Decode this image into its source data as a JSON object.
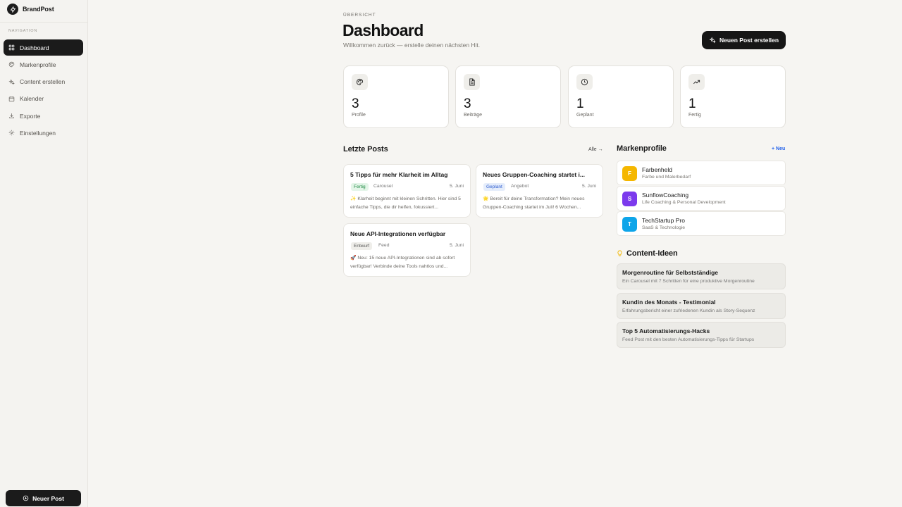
{
  "sidebar": {
    "brand": "BrandPost",
    "nav_header": "NAVIGATION",
    "items": [
      {
        "label": "Dashboard",
        "icon": "grid-icon",
        "active": true
      },
      {
        "label": "Markenprofile",
        "icon": "palette-icon",
        "active": false
      },
      {
        "label": "Content erstellen",
        "icon": "sparkles-icon",
        "active": false
      },
      {
        "label": "Kalender",
        "icon": "calendar-icon",
        "active": false
      },
      {
        "label": "Exporte",
        "icon": "download-icon",
        "active": false
      },
      {
        "label": "Einstellungen",
        "icon": "gear-icon",
        "active": false
      }
    ],
    "new_post_label": "Neuer Post"
  },
  "header": {
    "eyebrow": "ÜBERSICHT",
    "title": "Dashboard",
    "subtitle": "Willkommen zurück — erstelle deinen nächsten Hit.",
    "cta_label": "Neuen Post erstellen"
  },
  "stats": [
    {
      "value": "3",
      "label": "Profile",
      "icon": "palette-icon"
    },
    {
      "value": "3",
      "label": "Beiträge",
      "icon": "document-icon"
    },
    {
      "value": "1",
      "label": "Geplant",
      "icon": "clock-icon"
    },
    {
      "value": "1",
      "label": "Fertig",
      "icon": "trending-up-icon"
    }
  ],
  "recent_posts": {
    "title": "Letzte Posts",
    "all_label": "Alle →",
    "items": [
      {
        "title": "5 Tipps für mehr Klarheit im Alltag",
        "status": "Fertig",
        "type": "Carousel",
        "date": "5. Juni",
        "text": "✨ Klarheit beginnt mit kleinen Schritten. Hier sind 5 einfache Tipps, die dir helfen, fokussiert..."
      },
      {
        "title": "Neues Gruppen-Coaching startet i...",
        "status": "Geplant",
        "type": "Angebot",
        "date": "5. Juni",
        "text": "🌟 Bereit für deine Transformation? Mein neues Gruppen-Coaching startet im Juli! 6 Wochen..."
      },
      {
        "title": "Neue API-Integrationen verfügbar",
        "status": "Entwurf",
        "type": "Feed",
        "date": "5. Juni",
        "text": "🚀 Neu: 15 neue API-Integrationen sind ab sofort verfügbar! Verbinde deine Tools nahtlos und..."
      }
    ]
  },
  "profiles": {
    "title": "Markenprofile",
    "new_label": "+ Neu",
    "items": [
      {
        "initial": "F",
        "name": "Farbenheld",
        "sub": "Farbe und Malerbedarf",
        "color": "#f5b700"
      },
      {
        "initial": "S",
        "name": "SunflowCoaching",
        "sub": "Life Coaching & Personal Development",
        "color": "#7c3aed"
      },
      {
        "initial": "T",
        "name": "TechStartup Pro",
        "sub": "SaaS & Technologie",
        "color": "#0ea5e9"
      }
    ]
  },
  "ideas": {
    "title": "Content-Ideen",
    "items": [
      {
        "title": "Morgenroutine für Selbstständige",
        "sub": "Ein Carousel mit 7 Schritten für eine produktive Morgenroutine"
      },
      {
        "title": "Kundin des Monats - Testimonial",
        "sub": "Erfahrungsbericht einer zufriedenen Kundin als Story-Sequenz"
      },
      {
        "title": "Top 5 Automatisierungs-Hacks",
        "sub": "Feed Post mit den besten Automatisierungs-Tipps für Startups"
      }
    ]
  },
  "colors": {
    "accent": "#161616",
    "link": "#2563eb",
    "status_fertig_bg": "#e3f5e8",
    "status_fertig_fg": "#1f8a43",
    "status_geplant_bg": "#e5edfb",
    "status_geplant_fg": "#2c5bcf",
    "status_entwurf_bg": "#efeeea",
    "status_entwurf_fg": "#555555",
    "idea_bulb": "#f2b705"
  }
}
